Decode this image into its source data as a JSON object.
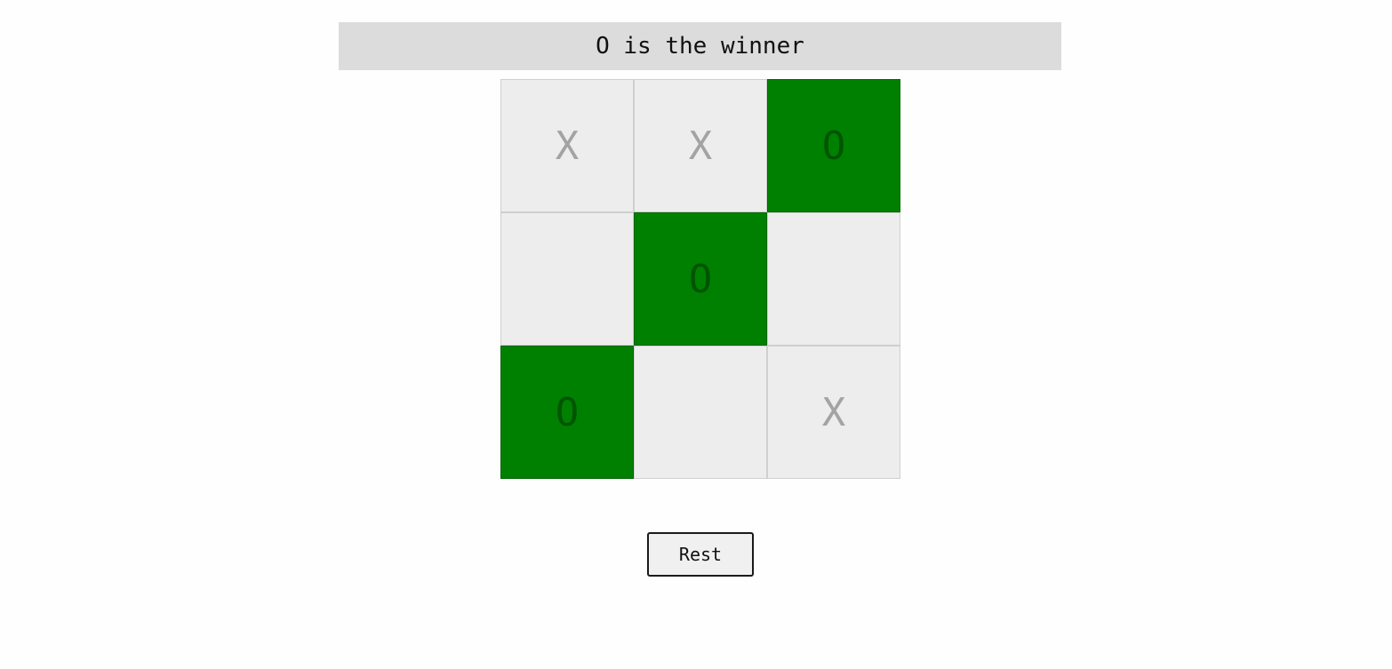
{
  "status": {
    "text": "O is the winner"
  },
  "board": {
    "cells": [
      {
        "mark": "X",
        "winner": false
      },
      {
        "mark": "X",
        "winner": false
      },
      {
        "mark": "O",
        "winner": true
      },
      {
        "mark": "",
        "winner": false
      },
      {
        "mark": "O",
        "winner": true
      },
      {
        "mark": "",
        "winner": false
      },
      {
        "mark": "O",
        "winner": true
      },
      {
        "mark": "",
        "winner": false
      },
      {
        "mark": "X",
        "winner": false
      }
    ]
  },
  "controls": {
    "reset_label": "Rest"
  },
  "colors": {
    "winner_cell": "#008000",
    "empty_cell": "#ededed",
    "status_bar": "#dcdcdc"
  }
}
